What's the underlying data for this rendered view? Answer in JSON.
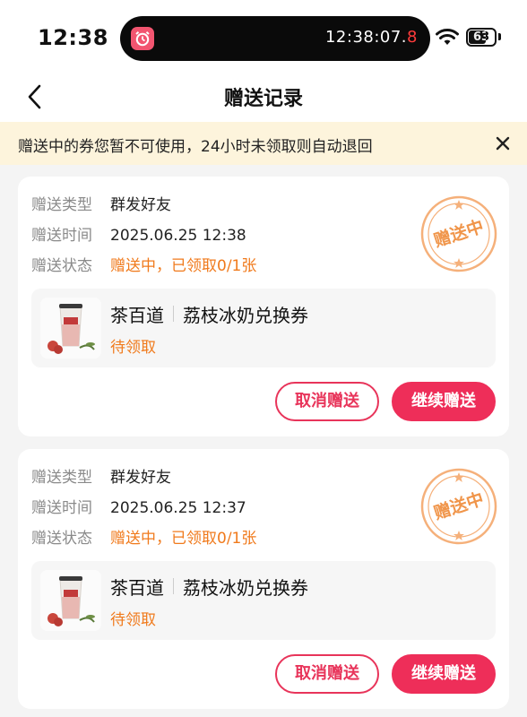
{
  "status_bar": {
    "time": "12:38",
    "island_time_main": "12:38:07.",
    "island_time_frac": "8",
    "battery": "63"
  },
  "nav": {
    "title": "赠送记录"
  },
  "notice": {
    "text": "赠送中的券您暂不可使用，24小时未领取则自动退回"
  },
  "labels": {
    "type": "赠送类型",
    "time": "赠送时间",
    "status": "赠送状态",
    "stamp": "赠送中",
    "cancel": "取消赠送",
    "continue": "继续赠送"
  },
  "records": [
    {
      "type": "群发好友",
      "time": "2025.06.25 12:38",
      "status": "赠送中，已领取0/1张",
      "coupon": {
        "brand": "茶百道",
        "name": "荔枝冰奶兑换券",
        "status": "待领取"
      }
    },
    {
      "type": "群发好友",
      "time": "2025.06.25 12:37",
      "status": "赠送中，已领取0/1张",
      "coupon": {
        "brand": "茶百道",
        "name": "荔枝冰奶兑换券",
        "status": "待领取"
      }
    }
  ],
  "colors": {
    "accent": "#ee2e59",
    "orange": "#f07a1c",
    "notice_bg": "#fdf4dc",
    "stamp": "#f5b07a"
  },
  "icons": [
    "alarm-icon",
    "wifi-icon",
    "back-icon",
    "close-icon",
    "stamp-icon",
    "drink-icon"
  ]
}
